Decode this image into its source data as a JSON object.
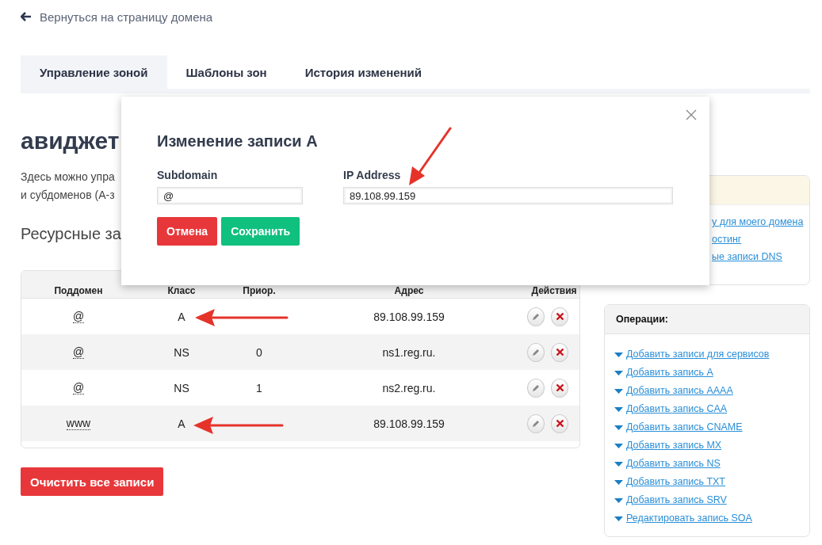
{
  "back_link": "Вернуться на страницу домена",
  "tabs": [
    {
      "label": "Управление зоной",
      "selected": true
    },
    {
      "label": "Шаблоны зон",
      "selected": false
    },
    {
      "label": "История изменений",
      "selected": false
    }
  ],
  "heading": "авиджет",
  "description": [
    "Здесь можно упра",
    "и субдоменов (А-з"
  ],
  "section_title": "Ресурсные за",
  "table": {
    "columns": [
      "Поддомен",
      "Класс",
      "Приор.",
      "Адрес",
      "Действия"
    ],
    "rows": [
      {
        "subdomain": "@",
        "class": "A",
        "priority": "",
        "address": "89.108.99.159"
      },
      {
        "subdomain": "@",
        "class": "NS",
        "priority": "0",
        "address": "ns1.reg.ru."
      },
      {
        "subdomain": "@",
        "class": "NS",
        "priority": "1",
        "address": "ns2.reg.ru."
      },
      {
        "subdomain": "www",
        "class": "A",
        "priority": "",
        "address": "89.108.99.159"
      }
    ]
  },
  "clear_button": "Очистить все записи",
  "help_card": {
    "links": [
      "у для моего домена",
      "остинг",
      "ые записи DNS"
    ]
  },
  "operations": {
    "title": "Операции:",
    "links": [
      "Добавить записи для сервисов",
      "Добавить запись A",
      "Добавить запись AAAA",
      "Добавить запись CAA",
      "Добавить запись CNAME",
      "Добавить запись MX",
      "Добавить запись NS",
      "Добавить запись TXT",
      "Добавить запись SRV",
      "Редактировать запись SOA"
    ]
  },
  "modal": {
    "title": "Изменение записи A",
    "fields": [
      {
        "label": "Subdomain",
        "value": "@"
      },
      {
        "label": "IP Address",
        "value": "89.108.99.159"
      }
    ],
    "buttons": [
      {
        "label": "Отмена",
        "kind": "cancel"
      },
      {
        "label": "Сохранить",
        "kind": "save"
      }
    ]
  }
}
